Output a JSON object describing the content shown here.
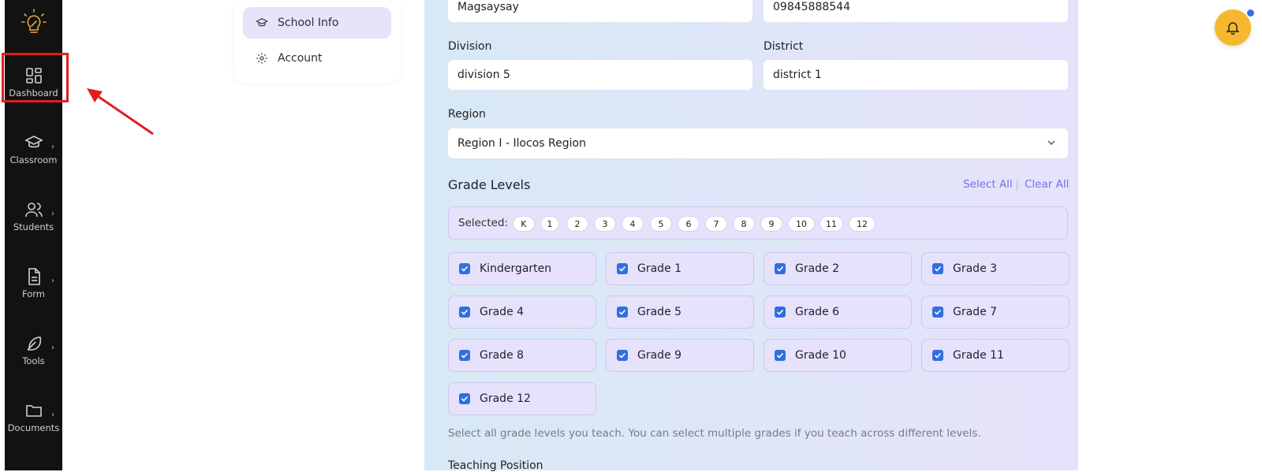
{
  "sidebar": {
    "items": [
      {
        "label": "Dashboard",
        "icon": "dashboard-grid-icon"
      },
      {
        "label": "Classroom",
        "icon": "graduation-cap-icon"
      },
      {
        "label": "Students",
        "icon": "users-icon"
      },
      {
        "label": "Form",
        "icon": "document-icon"
      },
      {
        "label": "Tools",
        "icon": "feather-icon"
      },
      {
        "label": "Documents",
        "icon": "folder-icon"
      }
    ]
  },
  "settings_nav": {
    "items": [
      {
        "label": "School Info",
        "icon": "graduation-cap-icon",
        "active": true
      },
      {
        "label": "Account",
        "icon": "gear-icon",
        "active": false
      }
    ]
  },
  "form": {
    "school_name_value": "Magsaysay",
    "phone_value": "09845888544",
    "division_label": "Division",
    "division_value": "division 5",
    "district_label": "District",
    "district_value": "district 1",
    "region_label": "Region",
    "region_value": "Region I - Ilocos Region",
    "grade_levels_title": "Grade Levels",
    "select_all": "Select All",
    "clear_all": "Clear All",
    "selected_label": "Selected:",
    "selected_chips": [
      "K",
      "1",
      "2",
      "3",
      "4",
      "5",
      "6",
      "7",
      "8",
      "9",
      "10",
      "11",
      "12"
    ],
    "grades": [
      {
        "name": "Kindergarten",
        "checked": true
      },
      {
        "name": "Grade 1",
        "checked": true
      },
      {
        "name": "Grade 2",
        "checked": true
      },
      {
        "name": "Grade 3",
        "checked": true
      },
      {
        "name": "Grade 4",
        "checked": true
      },
      {
        "name": "Grade 5",
        "checked": true
      },
      {
        "name": "Grade 6",
        "checked": true
      },
      {
        "name": "Grade 7",
        "checked": true
      },
      {
        "name": "Grade 8",
        "checked": true
      },
      {
        "name": "Grade 9",
        "checked": true
      },
      {
        "name": "Grade 10",
        "checked": true
      },
      {
        "name": "Grade 11",
        "checked": true
      },
      {
        "name": "Grade 12",
        "checked": true
      }
    ],
    "helper_text": "Select all grade levels you teach. You can select multiple grades if you teach across different levels.",
    "teaching_position_label": "Teaching Position"
  },
  "colors": {
    "accent": "#6f73e6",
    "checkbox": "#2f6fe0",
    "bell": "#f5b82e",
    "highlight": "#e01e1e"
  }
}
